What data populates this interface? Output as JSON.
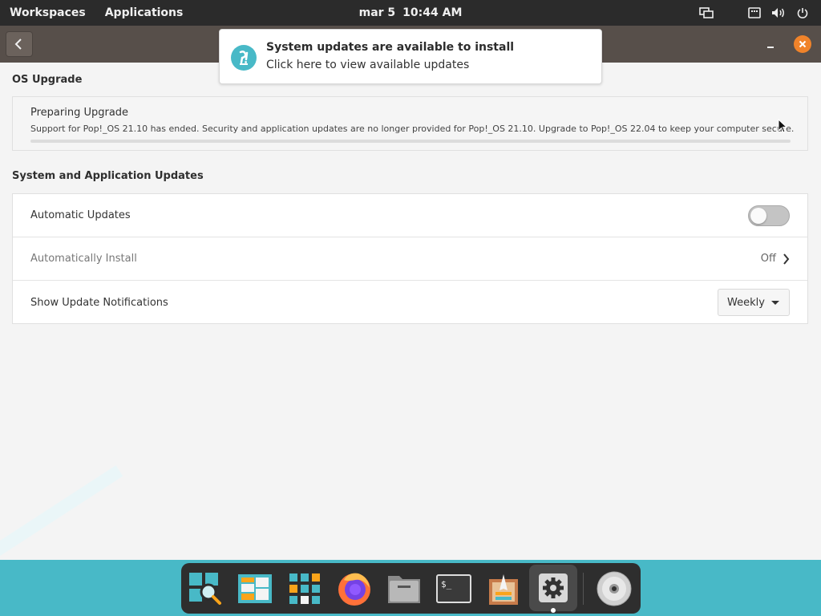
{
  "topbar": {
    "workspaces": "Workspaces",
    "applications": "Applications",
    "date": "mar 5",
    "time": "10:44 AM",
    "tray_icons": [
      "display-icon",
      "keyboard-icon",
      "volume-icon",
      "power-icon"
    ]
  },
  "window": {
    "back_icon": "chevron-left-icon",
    "minimize_icon": "minimize-icon",
    "close_icon": "close-icon",
    "close_color": "#f0832a"
  },
  "notification": {
    "title": "System updates are available to install",
    "body": "Click here to view available updates",
    "icon": "popos-logo-icon"
  },
  "os_upgrade": {
    "section_title": "OS Upgrade",
    "status": "Preparing Upgrade",
    "message": "Support for Pop!_OS 21.10 has ended. Security and application updates are no longer provided for Pop!_OS 21.10. Upgrade to Pop!_OS 22.04 to keep your computer secure.",
    "progress": 0
  },
  "updates": {
    "section_title": "System and Application Updates",
    "automatic_updates_label": "Automatic Updates",
    "automatic_updates_enabled": false,
    "automatically_install_label": "Automatically Install",
    "automatically_install_value": "Off",
    "notifications_label": "Show Update Notifications",
    "notifications_value": "Weekly"
  },
  "dock": {
    "items": [
      "search-app-icon",
      "workspaces-app-icon",
      "app-grid-icon",
      "firefox-icon",
      "files-icon",
      "terminal-icon",
      "pop-shop-icon",
      "settings-icon",
      "disc-icon"
    ],
    "active": "settings-icon",
    "accent": "#48b9c7"
  }
}
